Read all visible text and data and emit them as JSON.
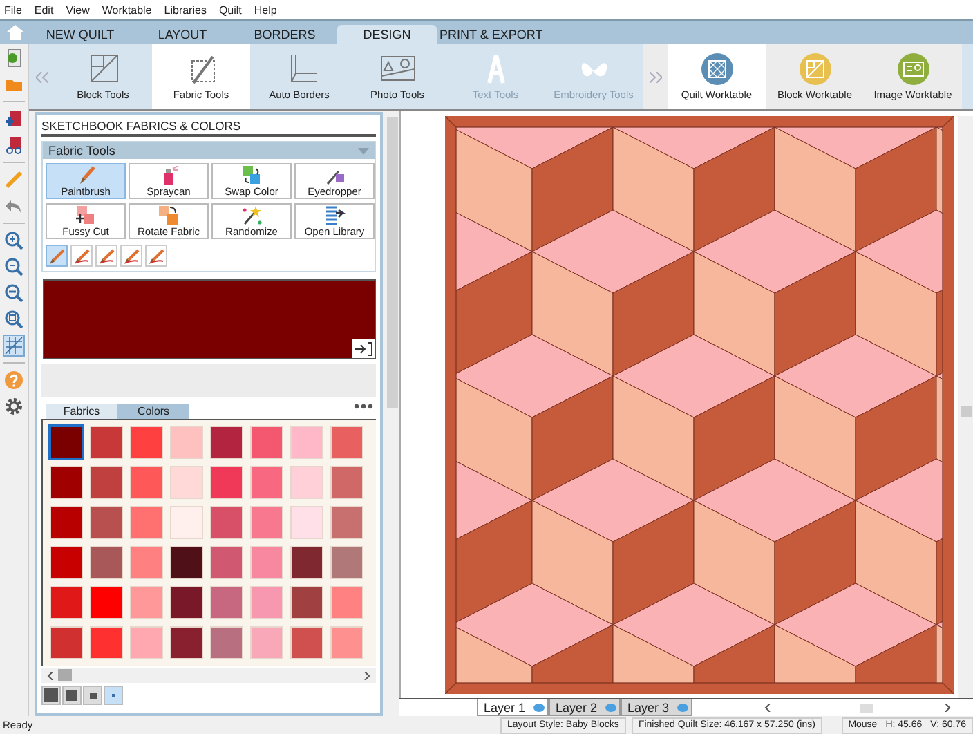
{
  "menu": [
    "File",
    "Edit",
    "View",
    "Worktable",
    "Libraries",
    "Quilt",
    "Help"
  ],
  "tabs": [
    {
      "label": "NEW QUILT",
      "selected": false
    },
    {
      "label": "LAYOUT",
      "selected": false
    },
    {
      "label": "BORDERS",
      "selected": false
    },
    {
      "label": "DESIGN",
      "selected": true
    },
    {
      "label": "PRINT & EXPORT",
      "selected": false
    }
  ],
  "ribbon_tools": [
    {
      "kind": "block",
      "label": "Block Tools",
      "selected": false,
      "disabled": false
    },
    {
      "kind": "fabric",
      "label": "Fabric Tools",
      "selected": true,
      "disabled": false
    },
    {
      "kind": "borders",
      "label": "Auto Borders",
      "selected": false,
      "disabled": false
    },
    {
      "kind": "photo",
      "label": "Photo Tools",
      "selected": false,
      "disabled": false
    },
    {
      "kind": "text",
      "label": "Text Tools",
      "selected": false,
      "disabled": true
    },
    {
      "kind": "embroidery",
      "label": "Embroidery Tools",
      "selected": false,
      "disabled": true
    }
  ],
  "worktables": [
    {
      "kind": "quilt",
      "label": "Quilt Worktable",
      "selected": true
    },
    {
      "kind": "block",
      "label": "Block Worktable",
      "selected": false
    },
    {
      "kind": "image",
      "label": "Image Worktable",
      "selected": false
    }
  ],
  "panel": {
    "title": "SKETCHBOOK FABRICS & COLORS",
    "section": "Fabric Tools",
    "tools": [
      {
        "kind": "paintbrush",
        "label": "Paintbrush",
        "selected": true
      },
      {
        "kind": "spraycan",
        "label": "Spraycan",
        "selected": false
      },
      {
        "kind": "swap",
        "label": "Swap Color",
        "selected": false
      },
      {
        "kind": "eyedropper",
        "label": "Eyedropper",
        "selected": false
      },
      {
        "kind": "fussy",
        "label": "Fussy Cut",
        "selected": false
      },
      {
        "kind": "rotate",
        "label": "Rotate Fabric",
        "selected": false
      },
      {
        "kind": "randomize",
        "label": "Randomize",
        "selected": false
      },
      {
        "kind": "library",
        "label": "Open Library",
        "selected": false
      }
    ],
    "brush_modes": [
      {
        "selected": true
      },
      {
        "selected": false
      },
      {
        "selected": false
      },
      {
        "selected": false
      },
      {
        "selected": false
      }
    ],
    "library_tabs": [
      {
        "label": "Fabrics",
        "selected": false
      },
      {
        "label": "Colors",
        "selected": true
      }
    ],
    "swatches": [
      {
        "color": "#7a0000",
        "selected": true
      },
      {
        "color": "#c83838",
        "selected": false
      },
      {
        "color": "#ff4040",
        "selected": false
      },
      {
        "color": "#ffc0c0",
        "selected": false
      },
      {
        "color": "#b22440",
        "selected": false
      },
      {
        "color": "#f45870",
        "selected": false
      },
      {
        "color": "#ffb8c8",
        "selected": false
      },
      {
        "color": "#e86060",
        "selected": false
      },
      {
        "color": "#a00000",
        "selected": false
      },
      {
        "color": "#c04040",
        "selected": false
      },
      {
        "color": "#ff5858",
        "selected": false
      },
      {
        "color": "#ffd8d8",
        "selected": false
      },
      {
        "color": "#f03858",
        "selected": false
      },
      {
        "color": "#f86880",
        "selected": false
      },
      {
        "color": "#ffd0d8",
        "selected": false
      },
      {
        "color": "#d06868",
        "selected": false
      },
      {
        "color": "#b80000",
        "selected": false
      },
      {
        "color": "#b85050",
        "selected": false
      },
      {
        "color": "#ff7070",
        "selected": false
      },
      {
        "color": "#fff0ee",
        "selected": false
      },
      {
        "color": "#d85068",
        "selected": false
      },
      {
        "color": "#f87890",
        "selected": false
      },
      {
        "color": "#ffe0e8",
        "selected": false
      },
      {
        "color": "#c87070",
        "selected": false
      },
      {
        "color": "#c80000",
        "selected": false
      },
      {
        "color": "#a85858",
        "selected": false
      },
      {
        "color": "#ff8080",
        "selected": false
      },
      {
        "color": "#501018",
        "selected": false
      },
      {
        "color": "#d05870",
        "selected": false
      },
      {
        "color": "#f888a0",
        "selected": false
      },
      {
        "color": "#802830",
        "selected": false
      },
      {
        "color": "#b07878",
        "selected": false
      },
      {
        "color": "#e01818",
        "selected": false
      },
      {
        "color": "#ff0000",
        "selected": false
      },
      {
        "color": "#ff9898",
        "selected": false
      },
      {
        "color": "#781828",
        "selected": false
      },
      {
        "color": "#c86880",
        "selected": false
      },
      {
        "color": "#f898b0",
        "selected": false
      },
      {
        "color": "#a04040",
        "selected": false
      },
      {
        "color": "#ff8181",
        "selected": false
      },
      {
        "color": "#d03030",
        "selected": false
      },
      {
        "color": "#ff3030",
        "selected": false
      },
      {
        "color": "#ffa8b0",
        "selected": false
      },
      {
        "color": "#882030",
        "selected": false
      },
      {
        "color": "#b87080",
        "selected": false
      },
      {
        "color": "#f8a8b8",
        "selected": false
      },
      {
        "color": "#d05050",
        "selected": false
      },
      {
        "color": "#ff9090",
        "selected": false
      }
    ],
    "swatch_sizes": [
      {
        "selected": false
      },
      {
        "selected": false
      },
      {
        "selected": false
      },
      {
        "selected": true
      }
    ]
  },
  "layers": [
    {
      "label": "Layer 1",
      "selected": true
    },
    {
      "label": "Layer 2",
      "selected": false
    },
    {
      "label": "Layer 3",
      "selected": false
    }
  ],
  "status_bar": {
    "message": "Ready",
    "layout_style": "Layout Style: Baby Blocks",
    "size": "Finished Quilt Size: 46.167 x 57.250 (ins)",
    "mouse": "Mouse",
    "h": "H: 45.66",
    "v": "V: 60.76"
  }
}
